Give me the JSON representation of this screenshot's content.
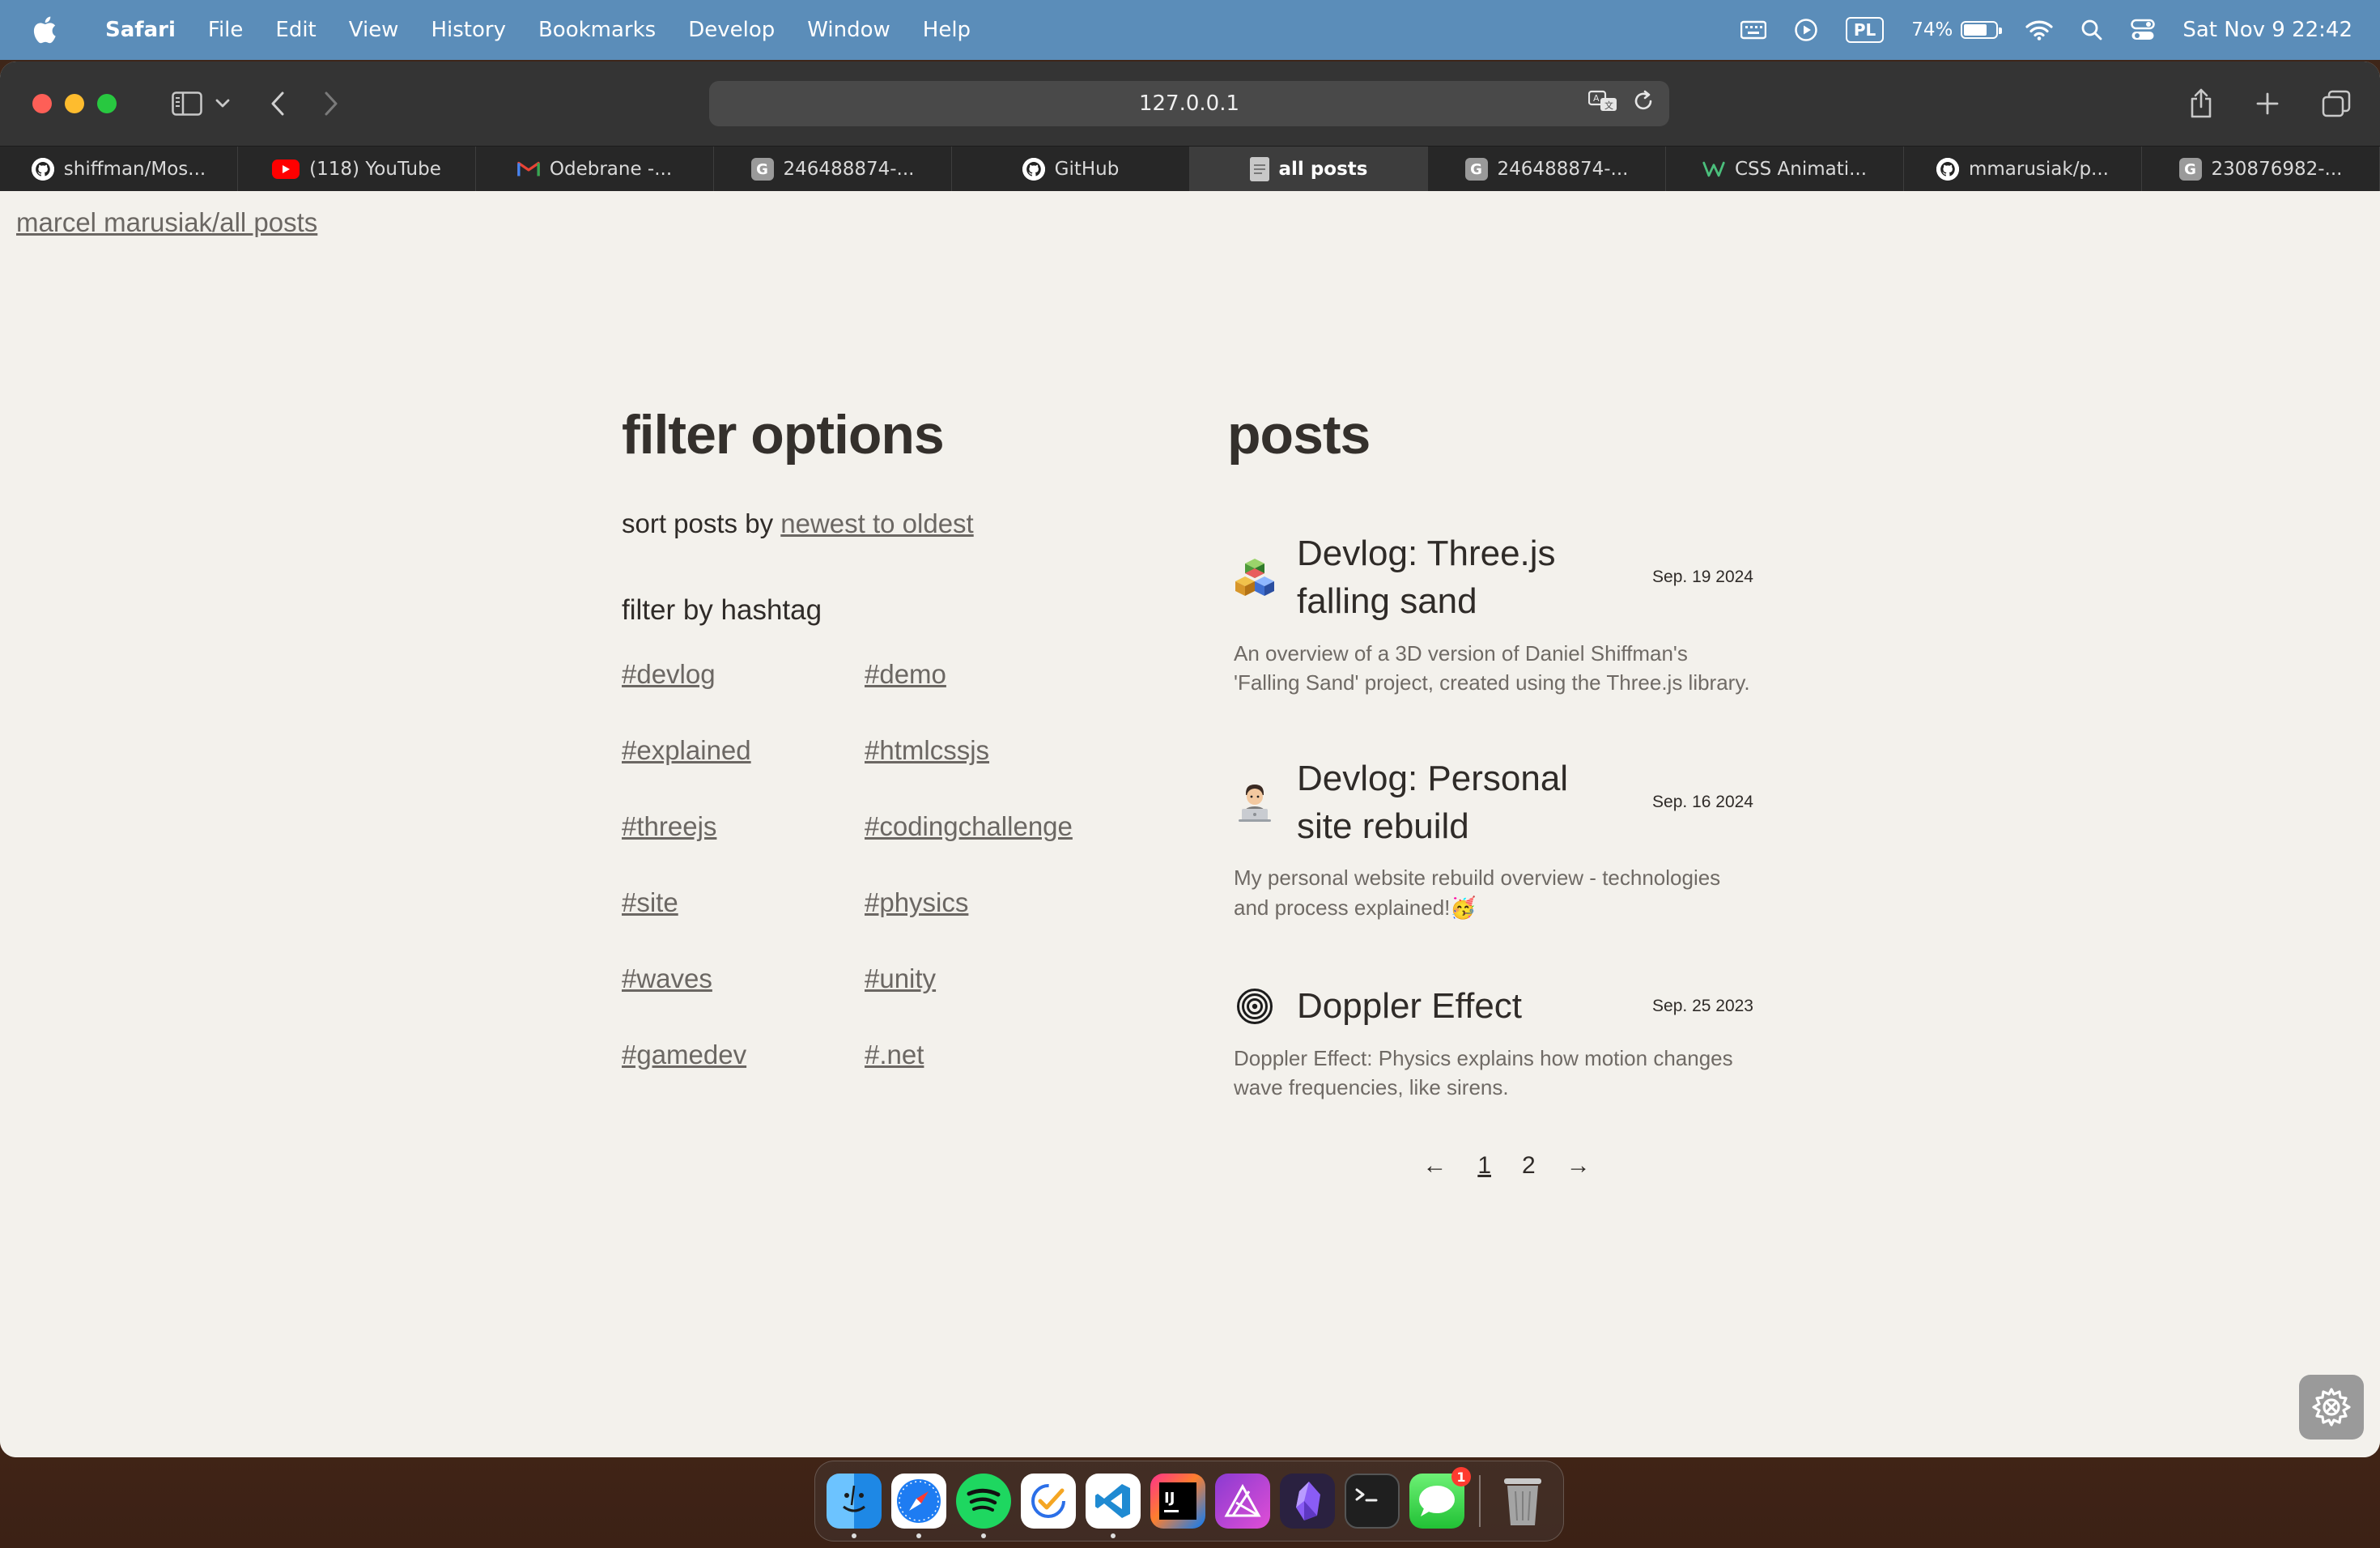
{
  "menubar": {
    "apple_icon": "apple-logo-icon",
    "app_name": "Safari",
    "menus": [
      "File",
      "Edit",
      "View",
      "History",
      "Bookmarks",
      "Develop",
      "Window",
      "Help"
    ],
    "keyboard_layout": "PL",
    "battery_percent": "74%",
    "battery_level": 0.74,
    "clock": "Sat Nov 9  22:42"
  },
  "browser": {
    "url": "127.0.0.1",
    "tabs": [
      {
        "label": "shiffman/Mos...",
        "icon": "github-icon"
      },
      {
        "label": "(118) YouTube",
        "icon": "youtube-icon"
      },
      {
        "label": "Odebrane -...",
        "icon": "gmail-icon"
      },
      {
        "label": "246488874-...",
        "icon": "g-icon"
      },
      {
        "label": "GitHub",
        "icon": "github-icon"
      },
      {
        "label": "all posts",
        "icon": "document-icon"
      },
      {
        "label": "246488874-...",
        "icon": "g-icon"
      },
      {
        "label": "CSS Animati...",
        "icon": "w-icon"
      },
      {
        "label": "mmarusiak/p...",
        "icon": "github-icon"
      },
      {
        "label": "230876982-...",
        "icon": "g-icon"
      }
    ],
    "active_tab": 5
  },
  "page": {
    "breadcrumb": "marcel marusiak/all posts",
    "filter": {
      "title": "filter options",
      "sort_prefix": "sort posts by ",
      "sort_value": "newest to oldest",
      "hashtag_title": "filter by hashtag",
      "hashtags": [
        "#devlog",
        "#demo",
        "#explained",
        "#htmlcssjs",
        "#threejs",
        "#codingchallenge",
        "#site",
        "#physics",
        "#waves",
        "#unity",
        "#gamedev",
        "#.net"
      ]
    },
    "posts": {
      "title": "posts",
      "items": [
        {
          "title": "Devlog: Three.js falling sand",
          "date": "Sep. 19 2024",
          "description": "An overview of a 3D version of Daniel Shiffman's 'Falling Sand' project, created using the Three.js library.",
          "icon": "cubes-icon"
        },
        {
          "title": "Devlog: Personal site rebuild",
          "date": "Sep. 16 2024",
          "description": "My personal website rebuild overview - technologies and process explained!🥳",
          "icon": "technologist-icon"
        },
        {
          "title": "Doppler Effect",
          "date": "Sep. 25 2023",
          "description": "Doppler Effect: Physics explains how motion changes wave frequencies, like sirens.",
          "icon": "concentric-circles-icon"
        }
      ]
    },
    "pagination": {
      "prev": "←",
      "pages": [
        "1",
        "2"
      ],
      "current": "1",
      "next": "→"
    }
  },
  "dock": {
    "apps": [
      "Finder",
      "Safari",
      "Spotify",
      "Tasks",
      "Visual Studio Code",
      "IntelliJ IDEA",
      "Affinity Designer",
      "Obsidian",
      "Terminal",
      "Messages",
      "Trash"
    ],
    "messages_badge": "1"
  }
}
